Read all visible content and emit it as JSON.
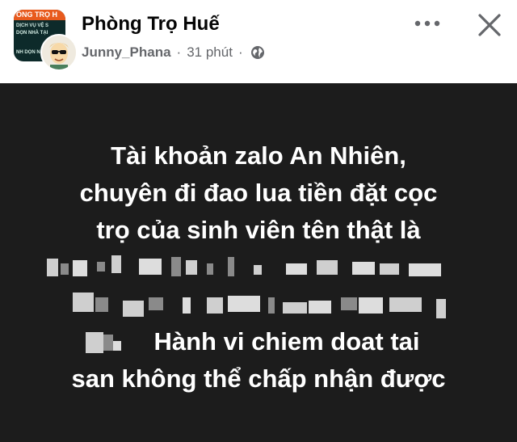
{
  "header": {
    "group_name": "Phòng Trọ Huế",
    "author": "Junny_Phana",
    "separator": "·",
    "time": "31 phút",
    "privacy_icon": "globe-icon",
    "more_icon": "more-horizontal-icon",
    "close_icon": "close-icon",
    "avatar_text": {
      "band": "ÒNG TRỌ H",
      "line1": "DỊCH VỤ VỆ S",
      "line2": "DỌN NHÀ TẠI",
      "line3": "NH DỌN N"
    }
  },
  "post": {
    "background": "#1c1c1c",
    "text_color": "#ffffff",
    "lines": [
      "Tài khoản zalo An Nhiên,",
      "chuyên đi đao lua tiền đặt cọc",
      "trọ của sinh viên tên thật là"
    ],
    "line_after_redaction": "Hành vi chiem doat tai",
    "last_line": "san không thể chấp nhận được"
  }
}
